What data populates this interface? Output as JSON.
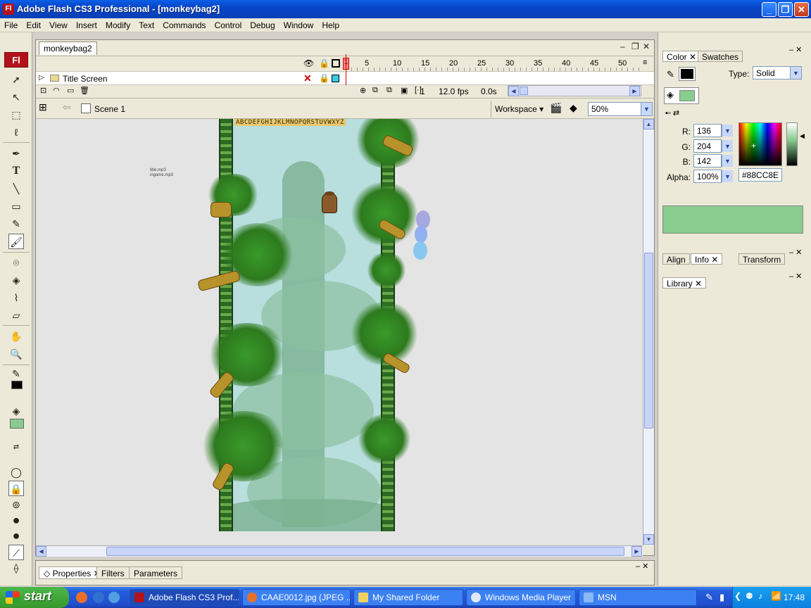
{
  "window": {
    "title": "Adobe Flash CS3 Professional - [monkeybag2]",
    "app_icon": "Fl",
    "minimize": "_",
    "maximize": "❐",
    "close": "✕"
  },
  "menubar": [
    "File",
    "Edit",
    "View",
    "Insert",
    "Modify",
    "Text",
    "Commands",
    "Control",
    "Debug",
    "Window",
    "Help"
  ],
  "tools": {
    "logo": "Fl"
  },
  "document": {
    "tab": "monkeybag2",
    "timeline": {
      "frame_numbers": [
        "1",
        "5",
        "10",
        "15",
        "20",
        "25",
        "30",
        "35",
        "40",
        "45",
        "50"
      ],
      "layer_name": "Title Screen",
      "current_frame": "1",
      "fps": "12.0 fps",
      "time": "0.0s"
    },
    "editbar": {
      "scene": "Scene 1",
      "workspace": "Workspace",
      "zoom": "50%"
    },
    "stage": {
      "alphabet": "ABCDEFGHIJKLMNOPQRSTUVWXYZ",
      "sound_labels": [
        "title.mp3",
        "ingame.mp3"
      ]
    }
  },
  "properties": {
    "tabs": [
      "Properties",
      "Filters",
      "Parameters"
    ]
  },
  "color_panel": {
    "tabs": [
      "Color",
      "Swatches"
    ],
    "type_label": "Type:",
    "type_value": "Solid",
    "r_label": "R:",
    "r_value": "136",
    "g_label": "G:",
    "g_value": "204",
    "b_label": "B:",
    "b_value": "142",
    "alpha_label": "Alpha:",
    "alpha_value": "100%",
    "hex": "#88CC8E",
    "fill_color": "#88cc8e"
  },
  "align_panel": {
    "tabs": [
      "Align",
      "Info",
      "Transform"
    ]
  },
  "library_panel": {
    "tabs": [
      "Library"
    ]
  },
  "taskbar": {
    "start": "start",
    "tasks": [
      {
        "label": "Adobe Flash CS3 Prof..."
      },
      {
        "label": "CAAE0012.jpg (JPEG ..."
      },
      {
        "label": "My Shared Folder"
      },
      {
        "label": "Windows Media Player"
      },
      {
        "label": "MSN"
      }
    ],
    "clock": "17:48"
  }
}
